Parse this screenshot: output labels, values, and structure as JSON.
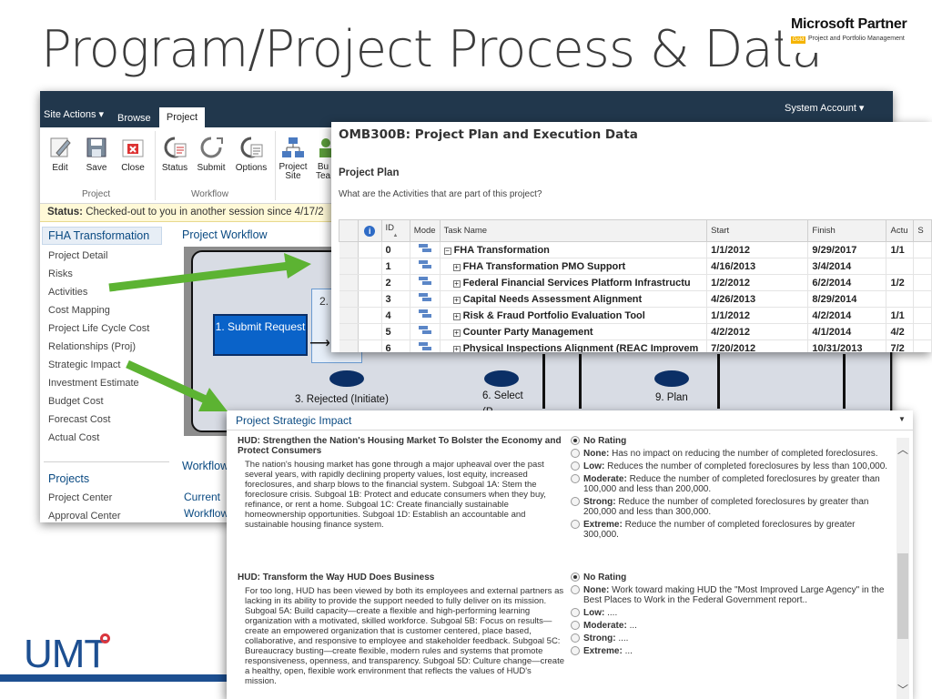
{
  "slide": {
    "title": "Program/Project Process & Data",
    "partner_name": "Microsoft Partner",
    "partner_badge": "Gold",
    "partner_competency": "Project and Portfolio Management",
    "company_logo": "UMT"
  },
  "sharepoint": {
    "top_tabs": {
      "site_actions": "Site Actions ▾",
      "browse": "Browse",
      "project": "Project"
    },
    "user": "System Account ▾",
    "ribbon": {
      "buttons": [
        {
          "label": "Edit"
        },
        {
          "label": "Save"
        },
        {
          "label": "Close"
        },
        {
          "label": "Status"
        },
        {
          "label": "Submit"
        },
        {
          "label": "Options"
        },
        {
          "label": "Project Site"
        },
        {
          "label": "Bu Tea"
        }
      ],
      "groups": {
        "project": "Project",
        "workflow": "Workflow"
      }
    },
    "status": {
      "label": "Status:",
      "text": "Checked-out to you in another session since 4/17/2"
    },
    "quick_launch": {
      "header": "FHA Transformation",
      "items": [
        "Project Detail",
        "Risks",
        "Activities",
        "Cost Mapping",
        "Project Life Cycle Cost",
        "Relationships (Proj)",
        "Strategic Impact",
        "Investment Estimate",
        "Budget Cost",
        "Forecast Cost",
        "Actual Cost"
      ],
      "projects_header": "Projects",
      "projects_items": [
        "Project Center",
        "Approval Center"
      ]
    },
    "workflow": {
      "title": "Project Workflow",
      "submit_request": "1. Submit Request",
      "initiate_partial": "2. In",
      "rejected": "3. Rejected (Initiate)",
      "select": "6. Select",
      "select_partial": "(P...",
      "plan": "9. Plan",
      "section_title": "Workflow",
      "links": [
        "Current",
        "Workflow"
      ]
    }
  },
  "omb": {
    "title": "OMB300B: Project Plan and Execution Data",
    "subtitle": "Project Plan",
    "question": "What are the Activities that are part of this project?",
    "columns": {
      "id": "ID",
      "mode": "Mode",
      "task": "Task Name",
      "start": "Start",
      "finish": "Finish",
      "actual": "Actu",
      "extra": "S"
    },
    "rows": [
      {
        "id": "0",
        "task": "FHA Transformation",
        "start": "1/1/2012",
        "finish": "9/29/2017",
        "actual": "1/1"
      },
      {
        "id": "1",
        "task": "FHA Transformation PMO Support",
        "start": "4/16/2013",
        "finish": "3/4/2014",
        "actual": ""
      },
      {
        "id": "2",
        "task": "Federal Financial Services Platform Infrastructu",
        "start": "1/2/2012",
        "finish": "6/2/2014",
        "actual": "1/2"
      },
      {
        "id": "3",
        "task": "Capital Needs Assessment Alignment",
        "start": "4/26/2013",
        "finish": "8/29/2014",
        "actual": ""
      },
      {
        "id": "4",
        "task": "Risk & Fraud Portfolio Evaluation Tool",
        "start": "1/1/2012",
        "finish": "4/2/2014",
        "actual": "1/1"
      },
      {
        "id": "5",
        "task": "Counter Party Management",
        "start": "4/2/2012",
        "finish": "4/1/2014",
        "actual": "4/2"
      },
      {
        "id": "6",
        "task": "Physical Inspections Alignment (REAC Improvem",
        "start": "7/20/2012",
        "finish": "10/31/2013",
        "actual": "7/2"
      }
    ]
  },
  "strategic_impact": {
    "title": "Project Strategic Impact",
    "goals": [
      {
        "title": "HUD: Strengthen the Nation's Housing Market To Bolster the Economy and Protect Consumers",
        "description": "The nation's housing market has gone through a major upheaval over the past several years, with rapidly declining property values, lost equity, increased foreclosures, and sharp blows to the financial system. Subgoal 1A: Stem the foreclosure crisis. Subgoal 1B: Protect and educate consumers when they buy, refinance, or rent a home. Subgoal 1C: Create financially sustainable homeownership opportunities. Subgoal 1D: Establish an accountable and sustainable housing finance system.",
        "ratings": [
          {
            "label": "No Rating",
            "text": "",
            "selected": true
          },
          {
            "label": "None:",
            "text": "Has no impact on reducing the number of completed foreclosures.",
            "selected": false
          },
          {
            "label": "Low:",
            "text": "Reduces the number of completed foreclosures by less than 100,000.",
            "selected": false
          },
          {
            "label": "Moderate:",
            "text": "Reduce the number of completed foreclosures by greater than 100,000 and less than 200,000.",
            "selected": false
          },
          {
            "label": "Strong:",
            "text": "Reduce the number of completed foreclosures by greater than 200,000 and less than 300,000.",
            "selected": false
          },
          {
            "label": "Extreme:",
            "text": "Reduce the number of completed foreclosures by greater 300,000.",
            "selected": false
          }
        ]
      },
      {
        "title": "HUD: Transform the Way HUD Does Business",
        "description": "For too long, HUD has been viewed by both its employees and external partners as lacking in its ability to provide the support needed to fully deliver on its mission. Subgoal 5A: Build capacity—create a flexible and high-performing learning organization with a motivated, skilled workforce. Subgoal 5B: Focus on results—create an empowered organization that is customer centered, place based, collaborative, and responsive to employee and stakeholder feedback. Subgoal 5C: Bureaucracy busting—create flexible, modern rules and systems that promote responsiveness, openness, and transparency. Subgoal 5D: Culture change—create a healthy, open, flexible work environment that reflects the values of HUD's mission.",
        "ratings": [
          {
            "label": "No Rating",
            "text": "",
            "selected": true
          },
          {
            "label": "None:",
            "text": "Work toward making HUD the \"Most Improved Large Agency\" in the Best Places to Work in the Federal Government report..",
            "selected": false
          },
          {
            "label": "Low:",
            "text": "....",
            "selected": false
          },
          {
            "label": "Moderate:",
            "text": "...",
            "selected": false
          },
          {
            "label": "Strong:",
            "text": "....",
            "selected": false
          },
          {
            "label": "Extreme:",
            "text": "...",
            "selected": false
          }
        ]
      }
    ]
  },
  "colors": {
    "accent_blue": "#0a4a82",
    "topbar": "#21374c",
    "arrow_green": "#5cb332",
    "umt_blue": "#1d4f91",
    "umt_red": "#d9363e"
  }
}
